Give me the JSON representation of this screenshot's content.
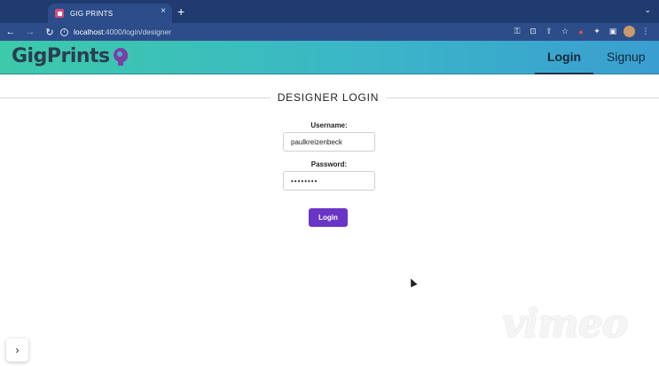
{
  "browser": {
    "tab_title": "GIG PRINTS",
    "tab_close": "×",
    "new_tab": "+",
    "menu_caret": "⌄",
    "back": "←",
    "forward": "→",
    "reload": "↻",
    "info": "i",
    "url_host": "localhost",
    "url_path": ":4000/login/designer",
    "toolbar_icons": [
      "key-icon",
      "install-icon",
      "share-icon",
      "star-icon",
      "record-icon",
      "extensions-icon",
      "sidepanel-icon",
      "avatar",
      "more-icon"
    ]
  },
  "header": {
    "logo_text": "GigPrints",
    "nav": {
      "login": "Login",
      "signup": "Signup"
    }
  },
  "login_form": {
    "title": "DESIGNER LOGIN",
    "username_label": "Username:",
    "username_value": "paulkreizenbeck",
    "password_label": "Password:",
    "password_value": "••••••••",
    "submit_label": "Login"
  },
  "watermark": "vimeo",
  "side_toggle": "›",
  "colors": {
    "tabstrip": "#1f3b70",
    "toolbar": "#2c4d8a",
    "header_gradient_start": "#3ccaa9",
    "header_gradient_end": "#3a9ed0",
    "login_button": "#6a35c6",
    "logo_accent": "#7b3fa6"
  }
}
